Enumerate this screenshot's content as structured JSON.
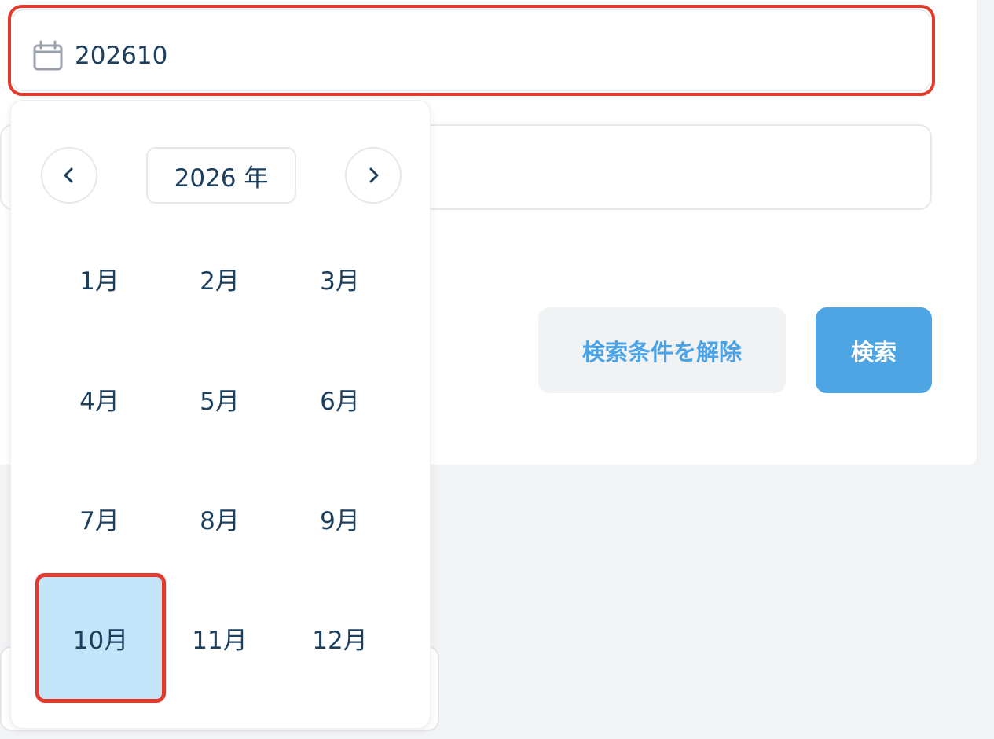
{
  "date_field": {
    "icon": "calendar-icon",
    "value": "202610"
  },
  "buttons": {
    "clear_label": "検索条件を解除",
    "search_label": "検索"
  },
  "picker": {
    "year_label": "2026 年",
    "prev_icon": "chevron-left-icon",
    "next_icon": "chevron-right-icon",
    "months": [
      "1月",
      "2月",
      "3月",
      "4月",
      "5月",
      "6月",
      "7月",
      "8月",
      "9月",
      "10月",
      "11月",
      "12月"
    ],
    "selected_month": "10月"
  },
  "colors": {
    "accent": "#4da5e3",
    "text": "#1d3f5e",
    "selected_bg": "#c4e4fa",
    "highlight_border": "#e23a2c"
  }
}
